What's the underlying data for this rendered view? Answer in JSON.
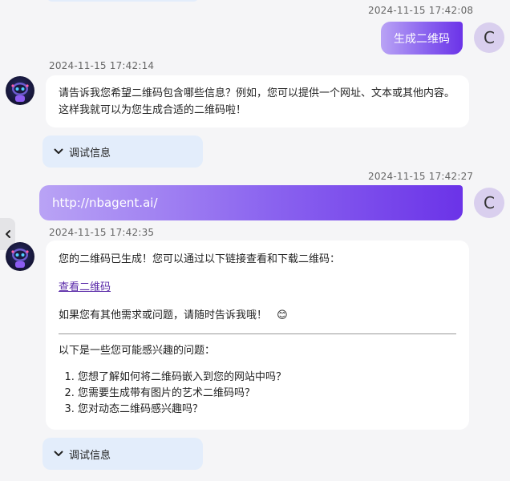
{
  "messages": [
    {
      "role": "user",
      "timestamp": "2024-11-15 17:42:08",
      "text": "生成二维码",
      "avatar_letter": "C"
    },
    {
      "role": "bot",
      "timestamp": "2024-11-15 17:42:14",
      "text": "请告诉我您希望二维码包含哪些信息？例如，您可以提供一个网址、文本或其他内容。这样我就可以为您生成合适的二维码啦！",
      "debug_label": "调试信息"
    },
    {
      "role": "user",
      "timestamp": "2024-11-15 17:42:27",
      "text": "http://nbagent.ai/",
      "avatar_letter": "C"
    },
    {
      "role": "bot",
      "timestamp": "2024-11-15 17:42:35",
      "intro": "您的二维码已生成！您可以通过以下链接查看和下载二维码：",
      "link_text": "查看二维码",
      "followup": "如果您有其他需求或问题，请随时告诉我哦！",
      "emoji": "😊",
      "questions_heading": "以下是一些您可能感兴趣的问题：",
      "questions": [
        "您想了解如何将二维码嵌入到您的网站中吗？",
        "您需要生成带有图片的艺术二维码吗？",
        "您对动态二维码感兴趣吗？"
      ],
      "debug_label": "调试信息"
    }
  ],
  "icons": {
    "side_tab": "chevron-left-icon",
    "debug": "chevron-down-icon"
  },
  "colors": {
    "user_gradient_start": "#b9a3f5",
    "user_gradient_end": "#6b33e8",
    "debug_bg": "#e3edfb",
    "page_bg": "#f5f5f7",
    "link": "#5a2aa8"
  }
}
